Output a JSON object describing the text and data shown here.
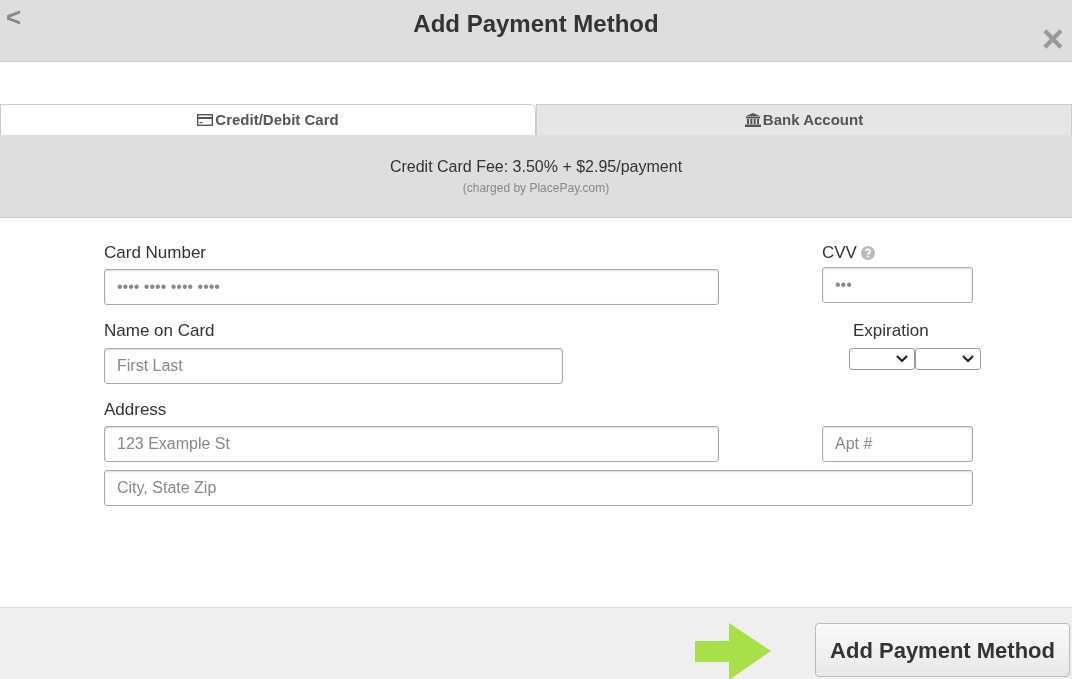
{
  "header": {
    "back": "<",
    "title": "Add Payment Method",
    "close": "×"
  },
  "tabs": [
    {
      "label": "Credit/Debit Card",
      "kind": "card",
      "selected": true
    },
    {
      "label": "Bank Account",
      "kind": "bank",
      "selected": false
    }
  ],
  "fee": {
    "text": "Credit Card Fee: 3.50% + $2.95/payment",
    "note": "(charged by PlacePay.com)"
  },
  "form": {
    "card_number": {
      "label": "Card Number",
      "placeholder": "•••• •••• •••• ••••"
    },
    "cvv": {
      "label": "CVV",
      "placeholder": "•••"
    },
    "name": {
      "label": "Name on Card",
      "placeholder": "First Last"
    },
    "expiration": {
      "label": "Expiration"
    },
    "address": {
      "label": "Address",
      "placeholder": "123 Example St"
    },
    "apt": {
      "placeholder": "Apt #"
    },
    "city": {
      "placeholder": "City, State Zip"
    }
  },
  "footer": {
    "button": "Add Payment Method"
  }
}
